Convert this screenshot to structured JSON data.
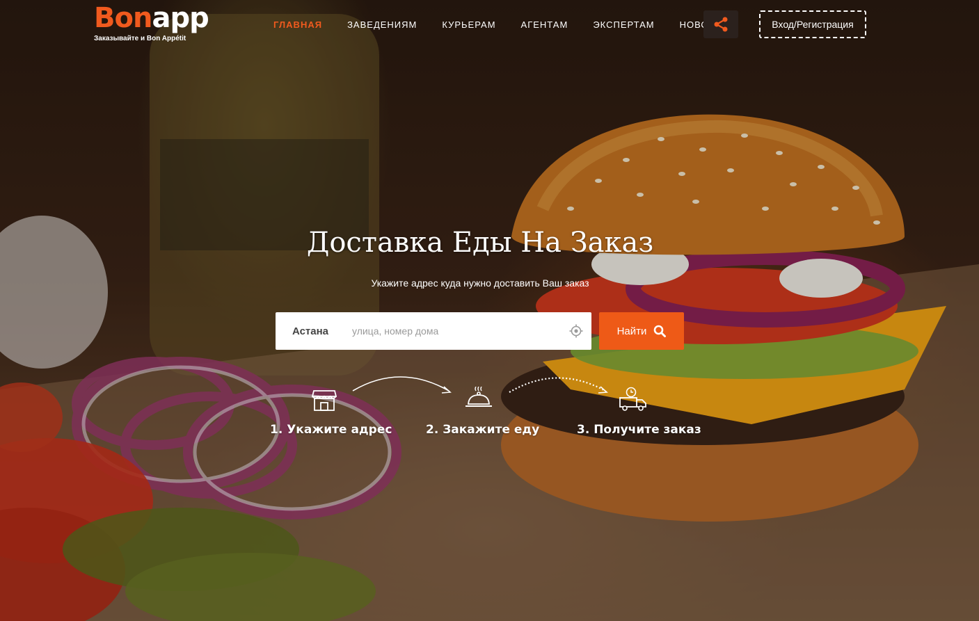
{
  "brand": {
    "logo_part1": "Bon",
    "logo_part2": "app",
    "tagline": "Заказывайте и Bon Appétit",
    "accent_color": "#f05a1e"
  },
  "nav": {
    "items": [
      {
        "label": "ГЛАВНАЯ",
        "active": true
      },
      {
        "label": "ЗАВЕДЕНИЯМ",
        "active": false
      },
      {
        "label": "КУРЬЕРАМ",
        "active": false
      },
      {
        "label": "АГЕНТАМ",
        "active": false
      },
      {
        "label": "ЭКСПЕРТАМ",
        "active": false
      },
      {
        "label": "НОВОСТИ",
        "active": false
      }
    ],
    "share_icon": "share-icon",
    "login_label": "Вход/Регистрация"
  },
  "hero": {
    "title": "Доставка Еды На Заказ",
    "subtitle": "Укажите адрес куда нужно доставить Ваш заказ"
  },
  "search": {
    "city": "Астана",
    "placeholder": "улица, номер дома",
    "value": "",
    "locate_icon": "crosshair-icon",
    "button_label": "Найти",
    "button_icon": "search-icon",
    "button_color": "#ee5a17"
  },
  "steps": [
    {
      "label": "1. Укажите адрес",
      "icon": "store-icon"
    },
    {
      "label": "2. Закажите еду",
      "icon": "cloche-icon"
    },
    {
      "label": "3. Получите заказ",
      "icon": "delivery-truck-icon"
    }
  ]
}
